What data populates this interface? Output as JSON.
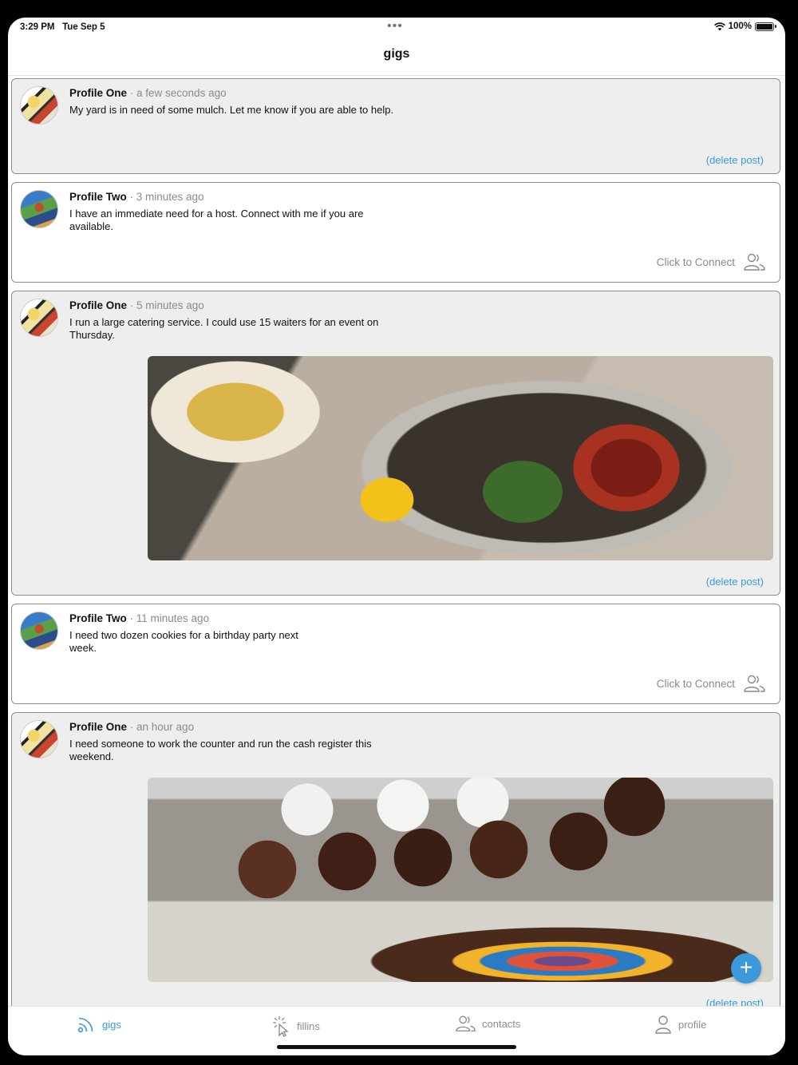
{
  "status_bar": {
    "time": "3:29 PM",
    "date": "Tue Sep 5",
    "dots": "•••",
    "battery": "100%",
    "battery_level": 1.0
  },
  "nav": {
    "title": "gigs"
  },
  "posts": [
    {
      "author": "Profile One",
      "separator": " · ",
      "time": "a few seconds ago",
      "body": "My yard is in need of some mulch. Let me know if you are able to help.",
      "action": "(delete post)"
    },
    {
      "author": "Profile Two",
      "separator": " · ",
      "time": "3 minutes ago",
      "body": "I have an immediate need for a host. Connect with me if you are available.",
      "action": "Click to Connect"
    },
    {
      "author": "Profile One",
      "separator": " · ",
      "time": "5 minutes ago",
      "body": "I run a large catering service. I could use 15 waiters for an event on Thursday.",
      "action": "(delete post)"
    },
    {
      "author": "Profile Two",
      "separator": " · ",
      "time": "11 minutes ago",
      "body": "I need two dozen cookies for a birthday party next week.",
      "action": "Click to Connect"
    },
    {
      "author": "Profile One",
      "separator": " · ",
      "time": "an hour ago",
      "body": "I need someone to work the counter and run the cash register this weekend.",
      "action": "(delete post)"
    }
  ],
  "fab": {
    "label": "+"
  },
  "tabs": [
    {
      "label": "gigs",
      "icon": "rss-icon",
      "active": true
    },
    {
      "label": "fillins",
      "icon": "cursor-click-icon",
      "active": false
    },
    {
      "label": "contacts",
      "icon": "people-icon",
      "active": false
    },
    {
      "label": "profile",
      "icon": "person-icon",
      "active": false
    }
  ],
  "colors": {
    "accent": "#3a9ad9",
    "own_post_bg": "#eeeeee",
    "muted_text": "#8a8a8a",
    "border": "#8e8e8e"
  }
}
